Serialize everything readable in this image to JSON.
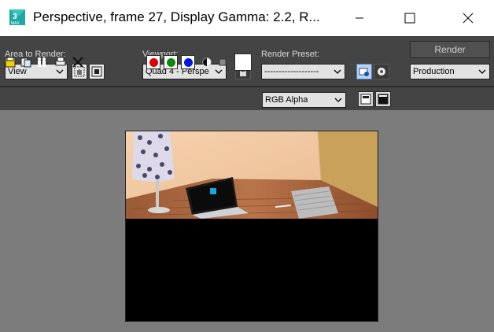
{
  "window": {
    "title": "Perspective, frame 27, Display Gamma: 2.2, R...",
    "icon": "3ds-max-app-icon"
  },
  "toolbar": {
    "area_to_render": {
      "label": "Area to Render:",
      "value": "View"
    },
    "viewport": {
      "label": "Viewport:",
      "value": "Quad 4 - Perspe"
    },
    "render_preset": {
      "label": "Render Preset:",
      "value": "-------------------"
    },
    "render_button": "Render",
    "production": {
      "value": "Production"
    },
    "channel": {
      "value": "RGB Alpha"
    }
  },
  "colors": {
    "toolbar_bg": "#444444",
    "viewport_bg": "#7c7c7c",
    "red_channel": "#e00000",
    "green_channel": "#0a8a0a",
    "blue_channel": "#0018d8"
  }
}
